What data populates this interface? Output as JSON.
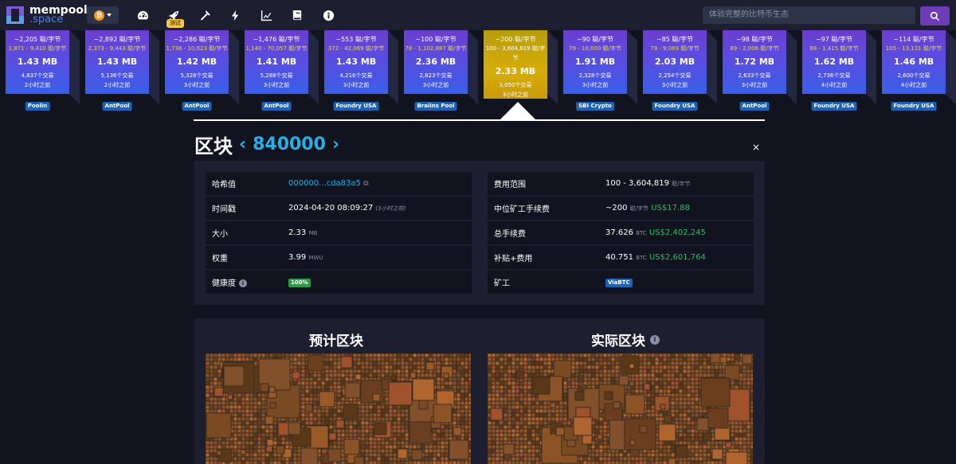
{
  "header": {
    "logo_top": "mempool",
    "logo_bottom": ".space",
    "network_symbol": "₿",
    "test_badge": "测试",
    "search_placeholder": "体验完整的比特币生态",
    "icons": [
      "dashboard-icon",
      "rocket-icon",
      "mining-icon",
      "lightning-icon",
      "graphs-icon",
      "docs-icon",
      "about-icon"
    ]
  },
  "blocks": [
    {
      "fee": "~2,205 聪/字节",
      "range": "1,871 - 9,410 聪/字节",
      "size": "1.43 MB",
      "txs": "4,837个交易",
      "time": "2小时之前",
      "pool": "Poolin"
    },
    {
      "fee": "~2,892 聪/字节",
      "range": "2,373 - 9,443 聪/字节",
      "size": "1.43 MB",
      "txs": "5,136个交易",
      "time": "2小时之前",
      "pool": "AntPool"
    },
    {
      "fee": "~2,286 聪/字节",
      "range": "1,736 - 10,023 聪/字节",
      "size": "1.42 MB",
      "txs": "5,328个交易",
      "time": "3小时之前",
      "pool": "AntPool"
    },
    {
      "fee": "~1,476 聪/字节",
      "range": "1,140 - 70,057 聪/字节",
      "size": "1.41 MB",
      "txs": "5,288个交易",
      "time": "3小时之前",
      "pool": "AntPool"
    },
    {
      "fee": "~553 聪/字节",
      "range": "372 - 42,069 聪/字节",
      "size": "1.43 MB",
      "txs": "4,216个交易",
      "time": "3小时之前",
      "pool": "Foundry USA"
    },
    {
      "fee": "~100 聪/字节",
      "range": "78 - 1,102,887 聪/字节",
      "size": "2.36 MB",
      "txs": "2,823个交易",
      "time": "3小时之前",
      "pool": "Braiins Pool"
    },
    {
      "fee": "~200 聪/字节",
      "range": "100 - 3,604,819 聪/字节",
      "size": "2.33 MB",
      "txs": "3,050个交易",
      "time": "3小时之前",
      "pool": ""
    },
    {
      "fee": "~90 聪/字节",
      "range": "79 - 10,000 聪/字节",
      "size": "1.91 MB",
      "txs": "2,328个交易",
      "time": "3小时之前",
      "pool": "SBI Crypto"
    },
    {
      "fee": "~85 聪/字节",
      "range": "79 - 9,069 聪/字节",
      "size": "2.03 MB",
      "txs": "2,254个交易",
      "time": "3小时之前",
      "pool": "Foundry USA"
    },
    {
      "fee": "~98 聪/字节",
      "range": "89 - 2,006 聪/字节",
      "size": "1.72 MB",
      "txs": "2,633个交易",
      "time": "3小时之前",
      "pool": "AntPool"
    },
    {
      "fee": "~97 聪/字节",
      "range": "88 - 1,415 聪/字节",
      "size": "1.62 MB",
      "txs": "2,736个交易",
      "time": "4小时之前",
      "pool": "Foundry USA"
    },
    {
      "fee": "~114 聪/字节",
      "range": "105 - 13,131 聪/字节",
      "size": "1.46 MB",
      "txs": "2,600个交易",
      "time": "4小时之前",
      "pool": "Foundry USA"
    }
  ],
  "block": {
    "title": "区块",
    "height": "840000",
    "close": "×",
    "left": [
      {
        "label": "哈希值",
        "value": "000000...cda83a5",
        "copy": "⧉"
      },
      {
        "label": "时间戳",
        "value": "2024-04-20 08:09:27",
        "extra": "(3小时之前)"
      },
      {
        "label": "大小",
        "value": "2.33",
        "unit": "MB"
      },
      {
        "label": "权重",
        "value": "3.99",
        "unit": "MWU"
      },
      {
        "label": "健康度",
        "info": "i",
        "badge": "100%"
      }
    ],
    "right": [
      {
        "label": "费用范围",
        "value": "100 - 3,604,819",
        "unit": "聪/字节"
      },
      {
        "label": "中位矿工手续费",
        "value": "~200",
        "unit": "聪/字节",
        "usd": "US$17.88"
      },
      {
        "label": "总手续费",
        "value": "37.626",
        "unit": "BTC",
        "usd": "US$2,402,245"
      },
      {
        "label": "补贴+费用",
        "value": "40.751",
        "unit": "BTC",
        "usd": "US$2,601,764"
      },
      {
        "label": "矿工",
        "badge": "ViaBTC"
      }
    ]
  },
  "maps": {
    "expected_title": "预计区块",
    "actual_title": "实际区块",
    "info": "i"
  },
  "colors": {
    "accent": "#25b0e6",
    "purple": "#6c3db6",
    "green": "#2fbd65",
    "selected": "#d6ad0a"
  }
}
